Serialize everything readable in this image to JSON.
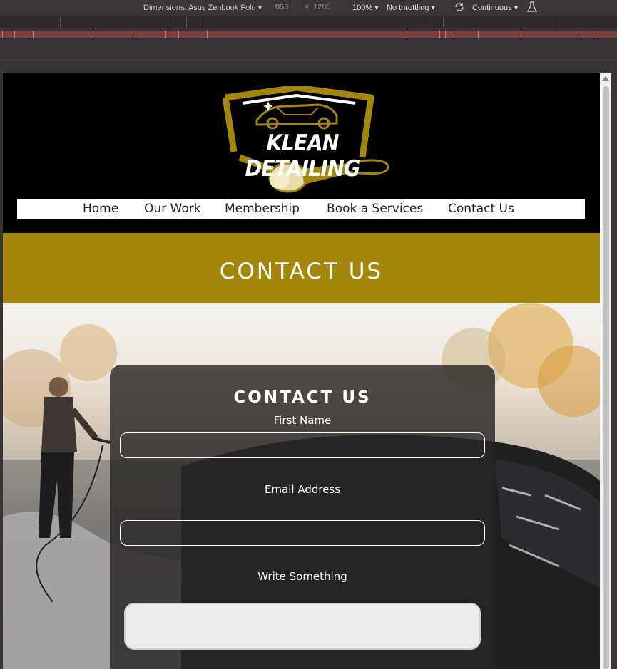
{
  "devtools": {
    "dimensions_label": "Dimensions: Asus Zenbook Fold",
    "width_value": "853",
    "times": "×",
    "height_value": "1280",
    "zoom": "100%",
    "throttling": "No throttling",
    "mode": "Continuous"
  },
  "site": {
    "logo_text": "KLEAN DETAILING",
    "nav": [
      "Home",
      "Our Work",
      "Membership",
      "Book a Services",
      "Contact Us"
    ],
    "banner_title": "CONTACT US"
  },
  "form": {
    "title": "CONTACT US",
    "first_name_label": "First Name",
    "first_name_value": "",
    "email_label": "Email Address",
    "email_value": "",
    "message_label": "Write Something",
    "message_value": ""
  },
  "colors": {
    "gold": "#a4870a",
    "header_bg": "#000000",
    "card_bg": "rgba(40,38,36,0.82)"
  }
}
